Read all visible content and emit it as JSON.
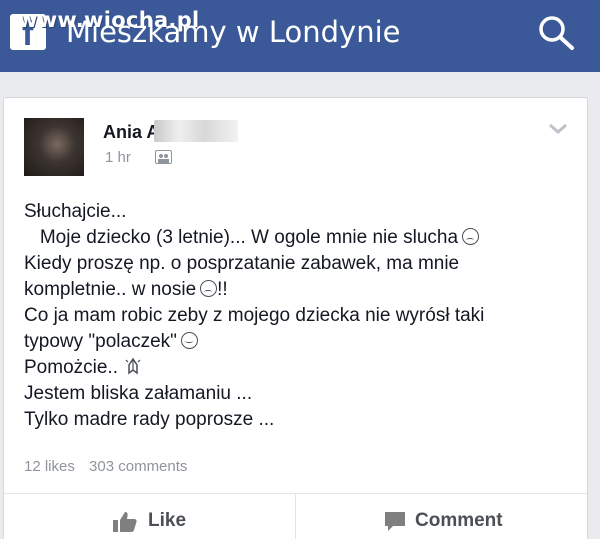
{
  "watermark": "www.wiocha.pl",
  "header": {
    "group_name": "Mieszkamy w Londynie",
    "logo_icon": "facebook-icon",
    "search_icon": "search-icon",
    "bar_color": "#3b5998"
  },
  "post": {
    "author": "Ania A",
    "time": "1 hr",
    "audience_icon": "group-audience-icon",
    "lines": [
      "Słuchajcie...",
      "   Moje dziecko (3 letnie)... W ogole mnie nie slucha",
      "Kiedy proszę np. o posprzatanie zabawek, ma mnie",
      "kompletnie.. w nosie",
      "Co ja mam robic zeby z mojego dziecka nie wyrósł taki",
      "typowy \"polaczek\"",
      "Pomożcie..",
      "Jestem bliska załamaniu ...",
      "Tylko madre rady poprosze ..."
    ],
    "line4_suffix": "!!",
    "likes": "12 likes",
    "comments": "303 comments"
  },
  "actions": {
    "like_label": "Like",
    "comment_label": "Comment"
  }
}
